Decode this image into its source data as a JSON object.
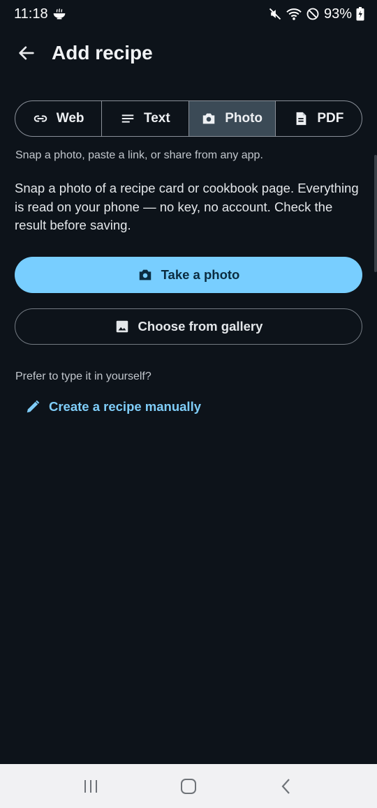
{
  "status": {
    "time": "11:18",
    "battery": "93%",
    "icons": [
      "bowl-icon",
      "mute-icon",
      "wifi-icon",
      "do-not-disturb-icon",
      "battery-icon"
    ]
  },
  "header": {
    "title": "Add recipe",
    "back_icon": "arrow-left-icon"
  },
  "tabs": [
    {
      "label": "Web",
      "icon": "link-icon",
      "active": false
    },
    {
      "label": "Text",
      "icon": "text-lines-icon",
      "active": false
    },
    {
      "label": "Photo",
      "icon": "camera-icon",
      "active": true
    },
    {
      "label": "PDF",
      "icon": "document-icon",
      "active": false
    }
  ],
  "hint": "Snap a photo, paste a link, or share from any app.",
  "description": "Snap a photo of a recipe card or cookbook page. Everything is read on your phone — no key, no account. Check the result before saving.",
  "actions": {
    "take_photo": "Take a photo",
    "gallery": "Choose from gallery"
  },
  "manual": {
    "prompt": "Prefer to type it in yourself?",
    "link": "Create a recipe manually"
  },
  "colors": {
    "background": "#0d131a",
    "primary": "#78ceff",
    "link": "#7fcdf8",
    "active_tab": "#3b4a56"
  }
}
